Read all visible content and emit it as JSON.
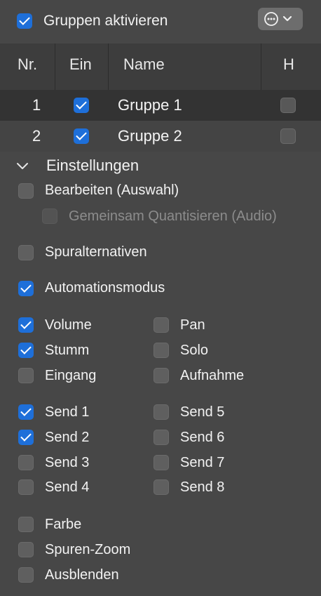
{
  "header": {
    "enable_groups_label": "Gruppen aktivieren",
    "enable_groups_checked": true,
    "options_icon": "ellipsis-circle-icon",
    "options_chevron_icon": "chevron-down-icon"
  },
  "table": {
    "columns": {
      "nr": "Nr.",
      "on": "Ein",
      "name": "Name",
      "hide": "H"
    },
    "rows": [
      {
        "nr": "1",
        "on": true,
        "name": "Gruppe 1",
        "hide": false
      },
      {
        "nr": "2",
        "on": true,
        "name": "Gruppe 2",
        "hide": false
      }
    ]
  },
  "settings": {
    "section_title": "Einstellungen",
    "disclosure_icon": "chevron-down-icon",
    "edit_selection": "Bearbeiten (Auswahl)",
    "quantize_audio": "Gemeinsam Quantisieren (Audio)",
    "track_alternatives": "Spuralternativen",
    "automation_mode": "Automationsmodus",
    "volume": "Volume",
    "pan": "Pan",
    "mute": "Stumm",
    "solo": "Solo",
    "input": "Eingang",
    "record": "Aufnahme",
    "send1": "Send 1",
    "send5": "Send 5",
    "send2": "Send 2",
    "send6": "Send 6",
    "send3": "Send 3",
    "send7": "Send 7",
    "send4": "Send 4",
    "send8": "Send 8",
    "color": "Farbe",
    "track_zoom": "Spuren-Zoom",
    "hide": "Ausblenden"
  },
  "colors": {
    "accent": "#1e6fd9",
    "background": "#474747",
    "table_bg": "#3d3d3d"
  }
}
